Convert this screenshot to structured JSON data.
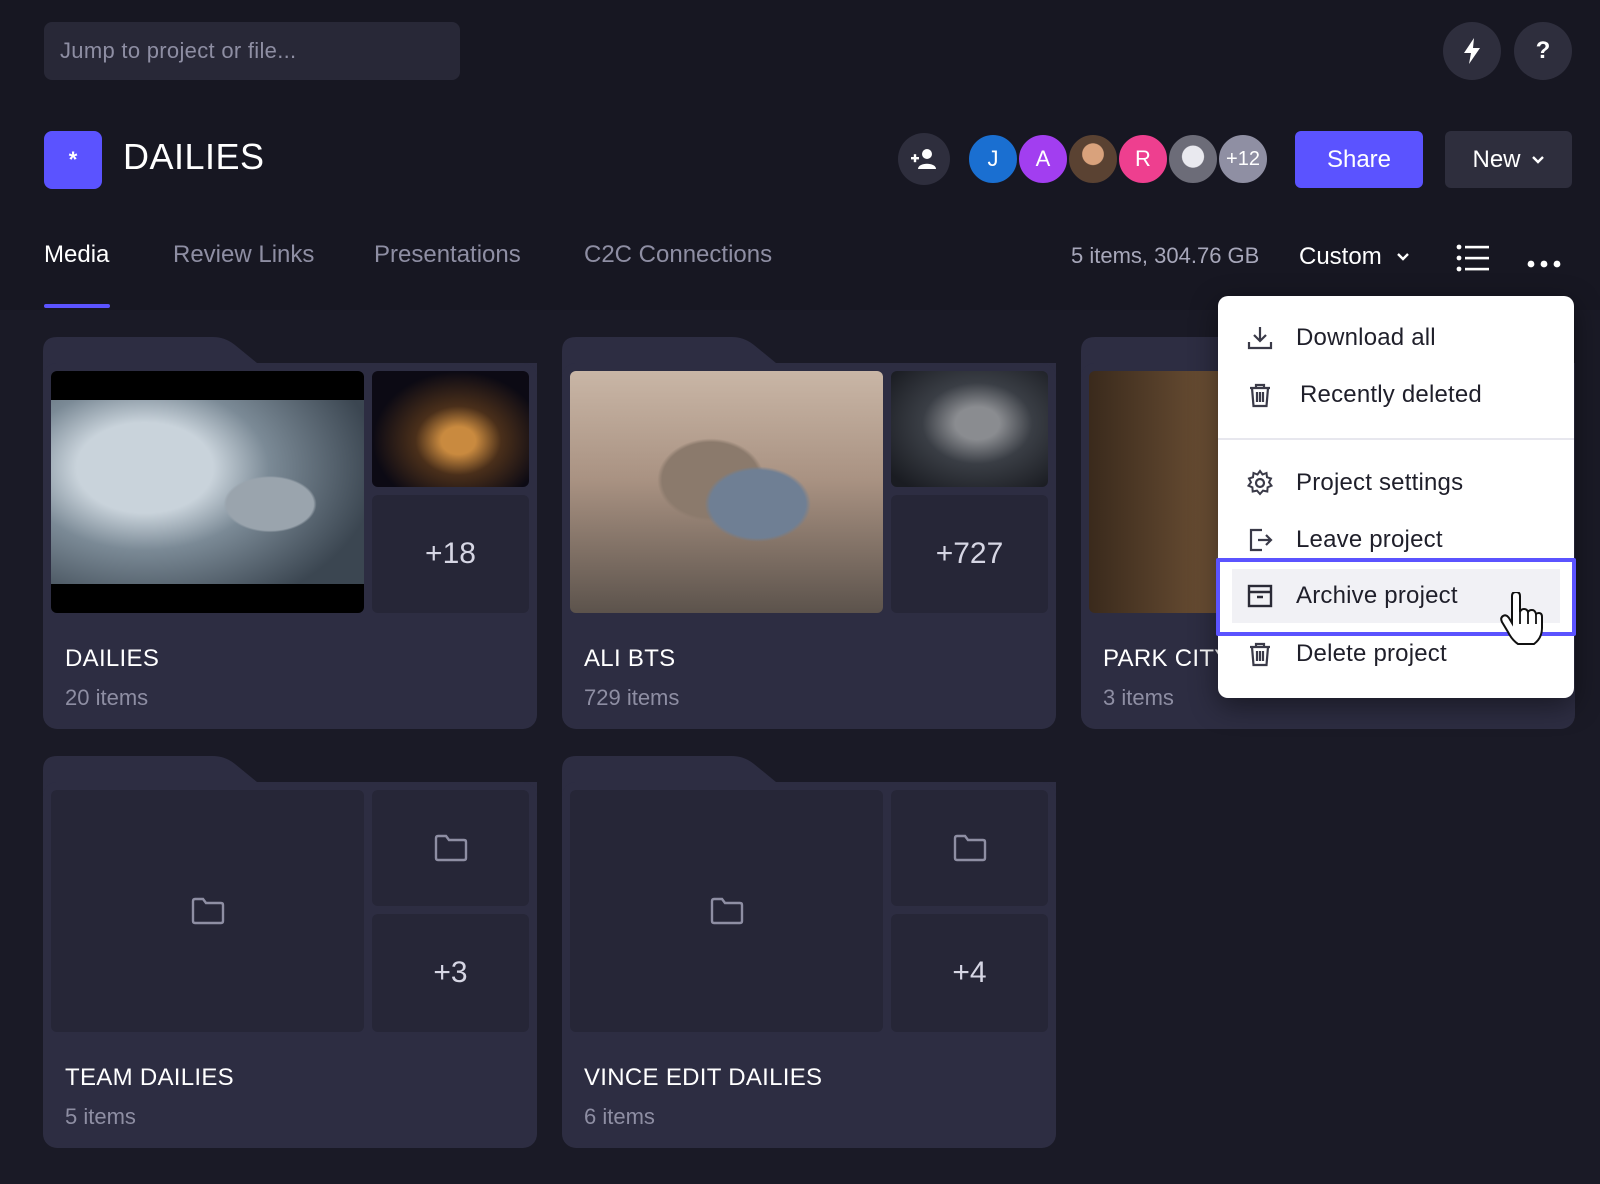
{
  "search": {
    "placeholder": "Jump to project or file..."
  },
  "header": {
    "help_label": "?",
    "project_icon_label": "*",
    "project_title": "DAILIES",
    "avatars": [
      {
        "label": "J",
        "color": "#1a6fd1"
      },
      {
        "label": "A",
        "color": "#a23ef0"
      },
      {
        "label": "",
        "color": "#8a6b52"
      },
      {
        "label": "R",
        "color": "#ee3f8f"
      },
      {
        "label": "",
        "color": "#9a9aa4"
      }
    ],
    "avatars_more": "+12",
    "share_label": "Share",
    "new_label": "New"
  },
  "tabs": [
    {
      "label": "Media",
      "active": true
    },
    {
      "label": "Review Links",
      "active": false
    },
    {
      "label": "Presentations",
      "active": false
    },
    {
      "label": "C2C Connections",
      "active": false
    }
  ],
  "toolbar": {
    "summary": "5 items, 304.76 GB",
    "sort_label": "Custom"
  },
  "folders": [
    {
      "name": "DAILIES",
      "count": "20 items",
      "more": "+18"
    },
    {
      "name": "ALI BTS",
      "count": "729 items",
      "more": "+727"
    },
    {
      "name": "PARK CITY",
      "count": "3 items",
      "more": ""
    },
    {
      "name": "TEAM DAILIES",
      "count": "5 items",
      "more": "+3"
    },
    {
      "name": "VINCE EDIT DAILIES",
      "count": "6 items",
      "more": "+4"
    }
  ],
  "menu": {
    "items": [
      {
        "label": "Download all",
        "icon": "download-icon"
      },
      {
        "label": "Recently deleted",
        "icon": "trash-icon"
      },
      {
        "label": "Project settings",
        "icon": "gear-icon"
      },
      {
        "label": "Leave project",
        "icon": "exit-icon"
      },
      {
        "label": "Archive project",
        "icon": "archive-icon",
        "highlighted": true
      },
      {
        "label": "Delete project",
        "icon": "trash-icon"
      }
    ]
  },
  "colors": {
    "background": "#1a1a26",
    "card": "#2d2d42",
    "accent": "#5b53ff",
    "muted_text": "#8e8ea3"
  }
}
